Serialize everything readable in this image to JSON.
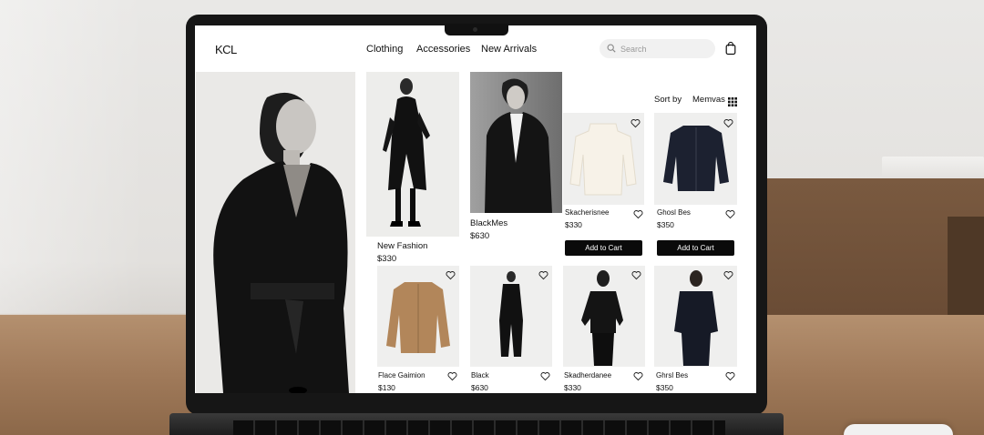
{
  "header": {
    "brand": "KCL",
    "nav": [
      "Clothing",
      "Accessories",
      "New Arrivals"
    ],
    "search_placeholder": "Search"
  },
  "toolbar": {
    "sort_label": "Sort by",
    "sort_value": "Memvas"
  },
  "featured": [
    {
      "name": "New Fashion",
      "price": "$330"
    },
    {
      "name": "BlackMes",
      "price": "$630"
    }
  ],
  "products_top": [
    {
      "name": "Skacherisnee",
      "price": "$330",
      "cta": "Add to Cart"
    },
    {
      "name": "Ghosl Bes",
      "price": "$350",
      "cta": "Add to Cart"
    }
  ],
  "products_bottom": [
    {
      "name": "Flace Gaimion",
      "price": "$130"
    },
    {
      "name": "Black",
      "price": "$630"
    },
    {
      "name": "Skadherdanee",
      "price": "$330"
    },
    {
      "name": "Ghrsl Bes",
      "price": "$350"
    }
  ],
  "icons": [
    "search-icon",
    "shopping-bag-icon",
    "grid-view-icon",
    "heart-icon"
  ],
  "colors": {
    "accent": "#0a0a0a",
    "background": "#ffffff",
    "search_bg": "#f1f1f1"
  }
}
